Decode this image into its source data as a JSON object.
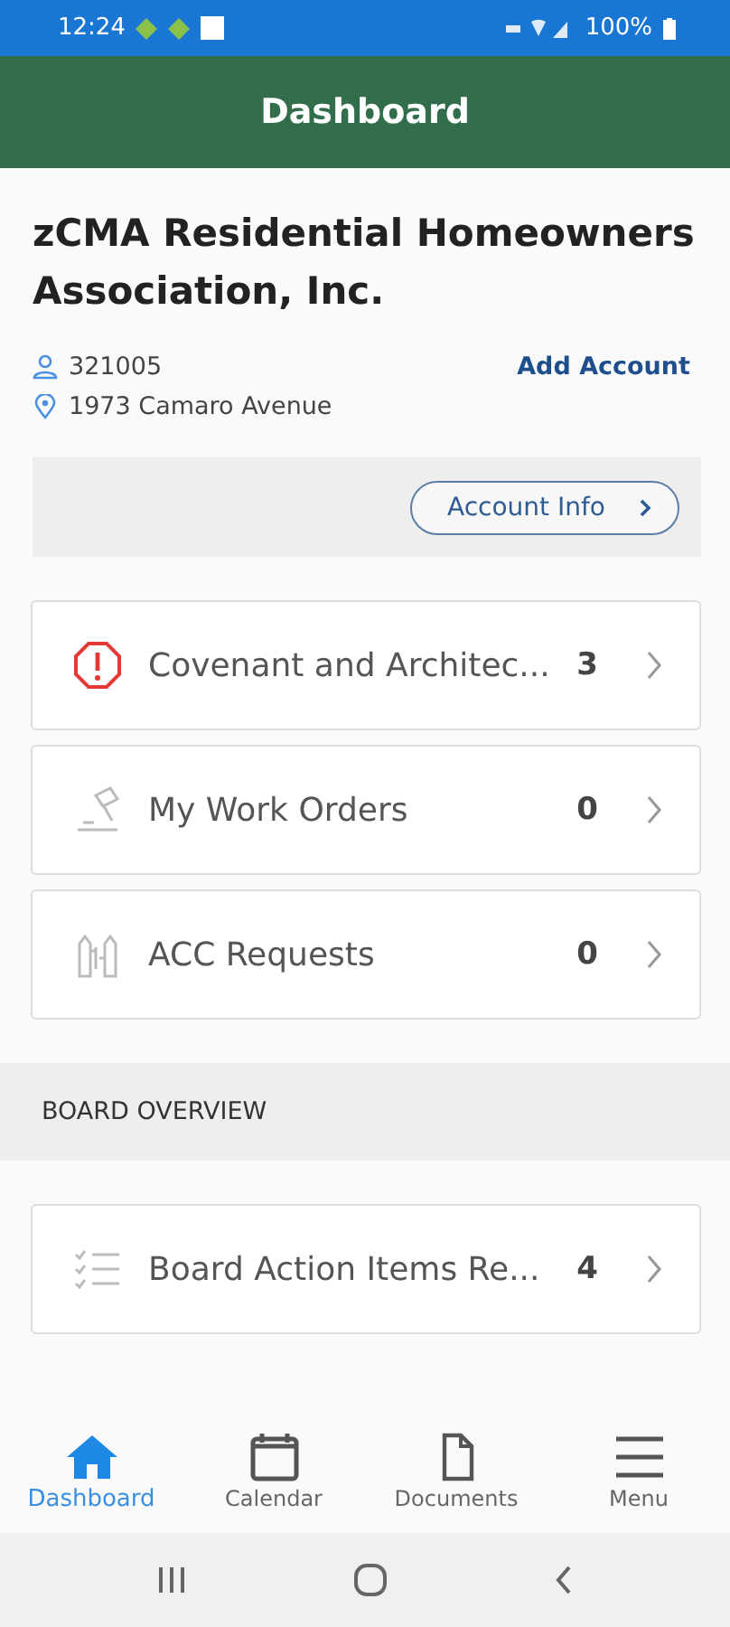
{
  "status_bar": {
    "time": "12:24",
    "battery": "100%"
  },
  "header": {
    "title": "Dashboard"
  },
  "association": {
    "name": "zCMA Residential Homeowners Association, Inc.",
    "account_number": "321005",
    "address": "1973 Camaro Avenue",
    "add_account": "Add Account",
    "account_info": "Account Info"
  },
  "items": [
    {
      "kind": "alert",
      "label": "Covenant and Architec...",
      "count": "3"
    },
    {
      "kind": "work",
      "label": "My Work Orders",
      "count": "0"
    },
    {
      "kind": "acc",
      "label": "ACC Requests",
      "count": "0"
    }
  ],
  "board": {
    "heading": "BOARD OVERVIEW",
    "items": [
      {
        "kind": "checklist",
        "label": "Board Action Items Re...",
        "count": "4"
      }
    ]
  },
  "nav": [
    {
      "kind": "home",
      "label": "Dashboard",
      "selected": true
    },
    {
      "kind": "calendar",
      "label": "Calendar",
      "selected": false
    },
    {
      "kind": "document",
      "label": "Documents",
      "selected": false
    },
    {
      "kind": "menu",
      "label": "Menu",
      "selected": false
    }
  ]
}
